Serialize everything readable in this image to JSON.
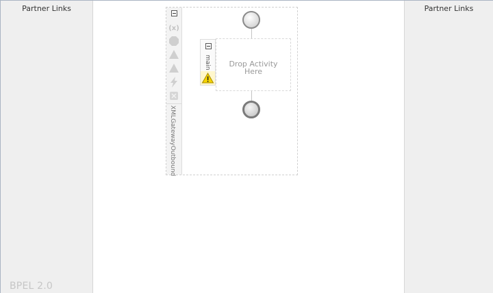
{
  "lanes": {
    "left_title": "Partner Links",
    "right_title": "Partner Links"
  },
  "version_label": "BPEL 2.0",
  "process": {
    "name": "XMLGatewayOutbound",
    "toolbar_icons": [
      "variables-icon",
      "correlation-icon",
      "fault-handler-icon",
      "event-handler-icon",
      "compensation-icon",
      "termination-icon"
    ]
  },
  "sequence": {
    "name": "main",
    "drop_text_line1": "Drop Activity",
    "drop_text_line2": "Here",
    "has_warning": true
  },
  "colors": {
    "lane_bg": "#efefef",
    "warning": "#f5d400",
    "node_border": "#8a8a8a"
  }
}
